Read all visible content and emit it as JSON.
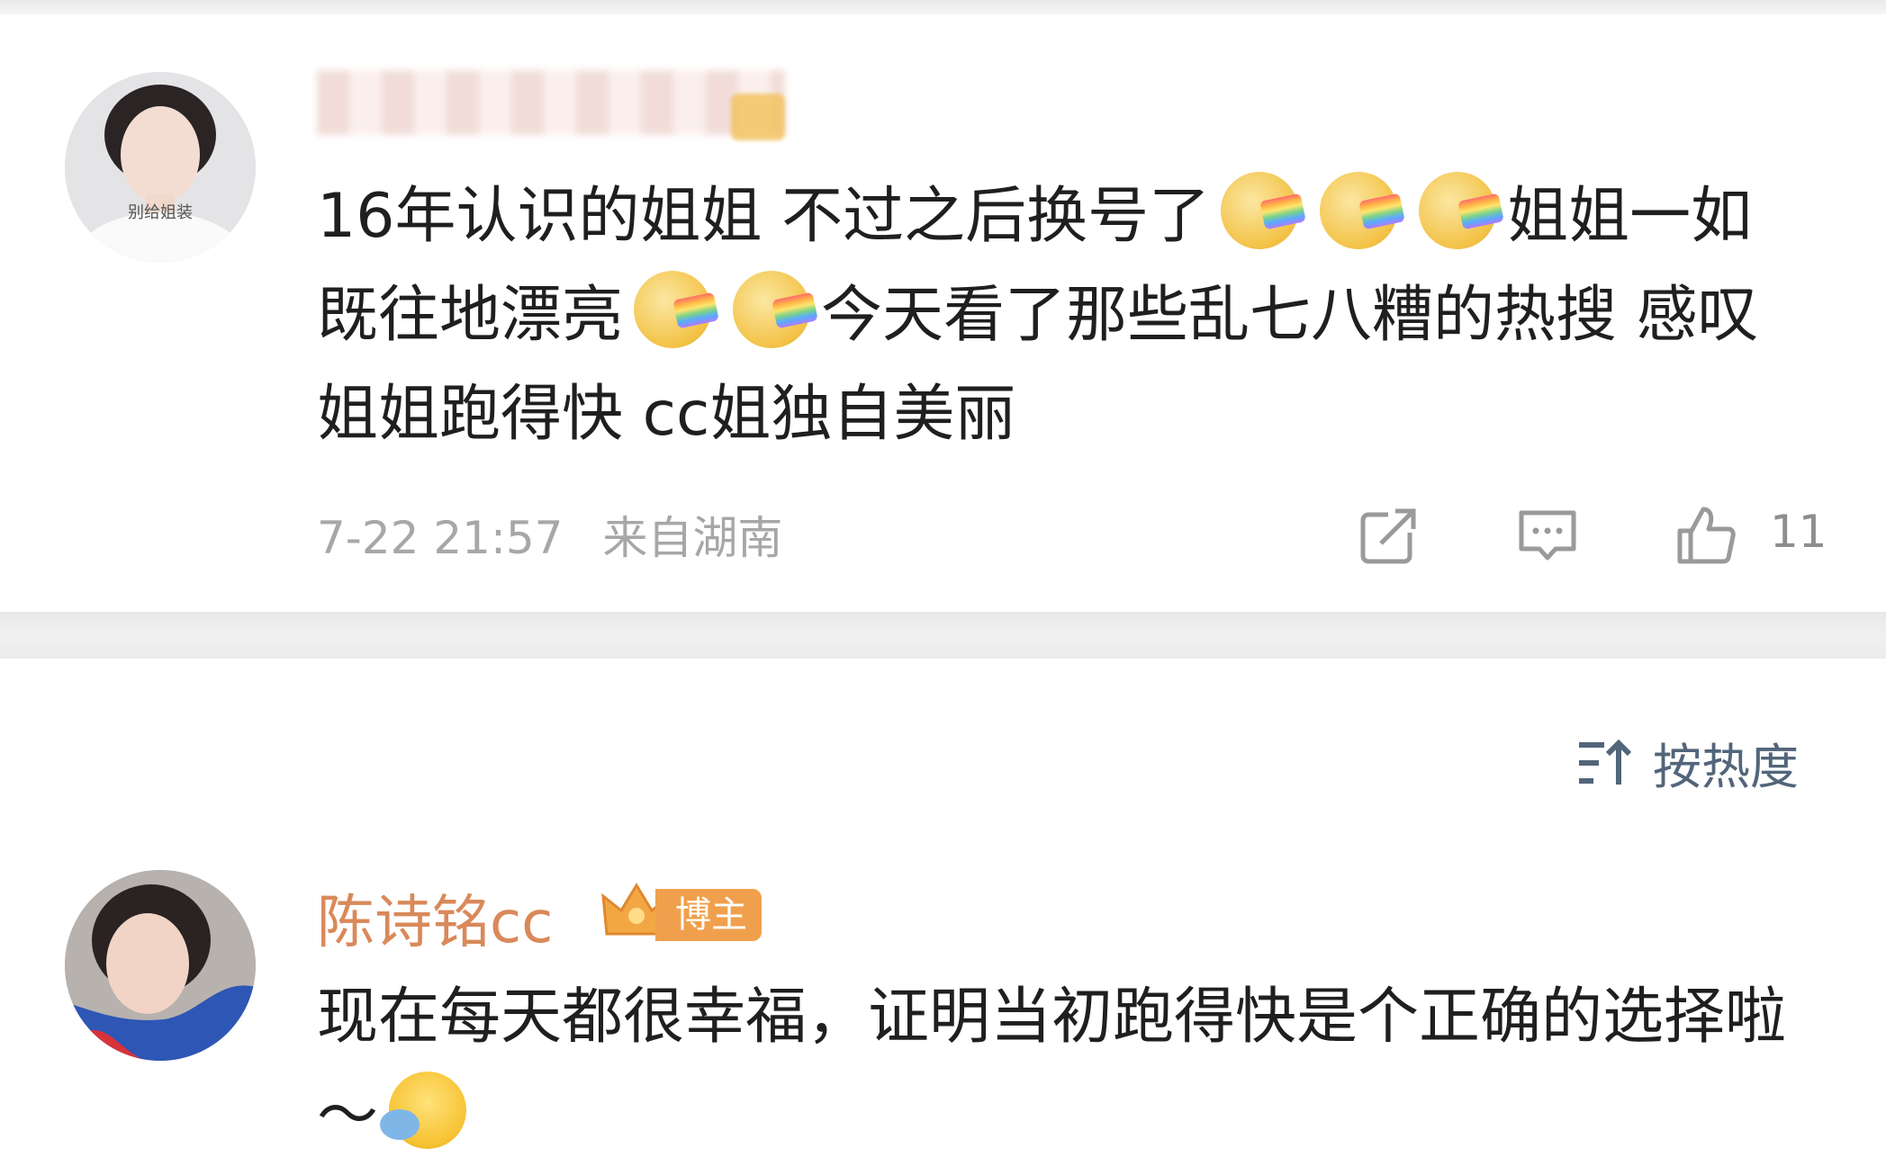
{
  "comment1": {
    "text_a": "16年认识的姐姐 不过之后换号了",
    "text_b": "姐姐一如既往地漂亮",
    "text_c": "今天看了那些乱七八糟的热搜 感叹姐姐跑得快 cc姐独自美丽",
    "avatar_label": "别给姐装",
    "time": "7-22 21:57",
    "location": "来自湖南",
    "like_count": "11"
  },
  "sort": {
    "label": "按热度"
  },
  "comment2": {
    "username": "陈诗铭cc",
    "badge": "博主",
    "text": "现在每天都很幸福，证明当初跑得快是个正确的选择啦～"
  },
  "icons": [
    "share-icon",
    "comment-icon",
    "like-icon",
    "sort-icon",
    "rainbow-emoji",
    "hug-emoji",
    "crown-icon"
  ],
  "colors": {
    "username": "#d9895a",
    "badge": "#f0a04c",
    "meta": "#a7a7a7",
    "sort": "#52657a"
  }
}
